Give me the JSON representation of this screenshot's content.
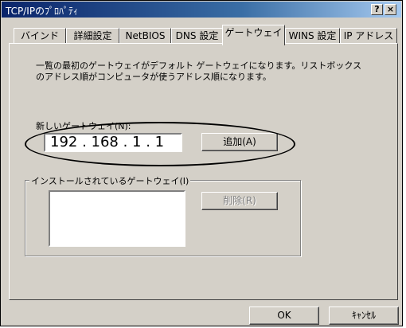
{
  "window": {
    "title": "TCP/IPのﾌﾟﾛﾊﾟﾃｨ",
    "help_button": "?",
    "close_button": "×"
  },
  "tabs": [
    {
      "label": "バインド"
    },
    {
      "label": "詳細設定"
    },
    {
      "label": "NetBIOS"
    },
    {
      "label": "DNS 設定"
    },
    {
      "label": "ゲートウェイ",
      "active": true
    },
    {
      "label": "WINS 設定"
    },
    {
      "label": "IP アドレス"
    }
  ],
  "description": {
    "line1": "一覧の最初のゲートウェイがデフォルト ゲートウェイになります。リストボックス",
    "line2": "のアドレス順がコンピュータが使うアドレス順になります。"
  },
  "new_gateway": {
    "label": "新しいゲートウェイ(N):",
    "value": "192 . 168 .  1   .  1",
    "add_button": "追加(A)"
  },
  "installed": {
    "label": "インストールされているゲートウェイ(I)",
    "remove_button": "削除(R)",
    "items": []
  },
  "footer": {
    "ok_button": "OK",
    "cancel_button": "ｷｬﾝｾﾙ"
  },
  "colors": {
    "title_bar": "#0a246a",
    "face": "#d4d0c8"
  }
}
